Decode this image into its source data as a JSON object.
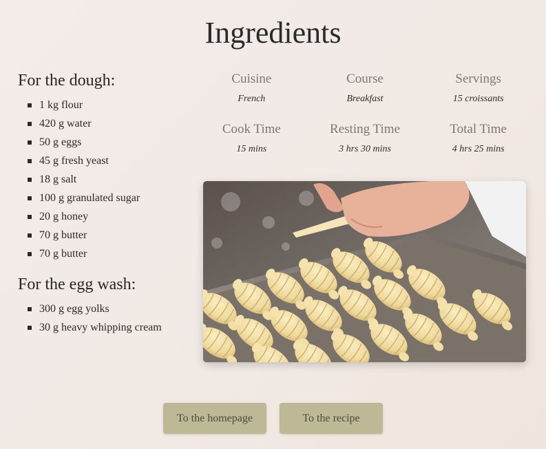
{
  "page": {
    "title": "Ingredients"
  },
  "ingredients": {
    "dough": {
      "heading": "For the dough:",
      "items": [
        "1 kg flour",
        "420 g water",
        "50 g eggs",
        "45 g fresh yeast",
        "18 g salt",
        "100 g granulated sugar",
        "20 g honey",
        "70 g butter",
        "70 g butter"
      ]
    },
    "egg_wash": {
      "heading": "For the egg wash:",
      "items": [
        "300 g egg yolks",
        "30 g heavy whipping cream"
      ]
    }
  },
  "meta": {
    "row1": [
      {
        "label": "Cuisine",
        "value": "French"
      },
      {
        "label": "Course",
        "value": "Breakfast"
      },
      {
        "label": "Servings",
        "value": "15 croissants"
      }
    ],
    "row2": [
      {
        "label": "Cook Time",
        "value": "15 mins"
      },
      {
        "label": "Resting Time",
        "value": "3 hrs 30 mins"
      },
      {
        "label": "Total Time",
        "value": "4 hrs 25 mins"
      }
    ]
  },
  "buttons": {
    "homepage": "To the homepage",
    "recipe": "To the recipe"
  },
  "colors": {
    "button_bg": "#bdb997",
    "button_text": "#4b4a3a",
    "page_bg": "#f2eae6"
  }
}
